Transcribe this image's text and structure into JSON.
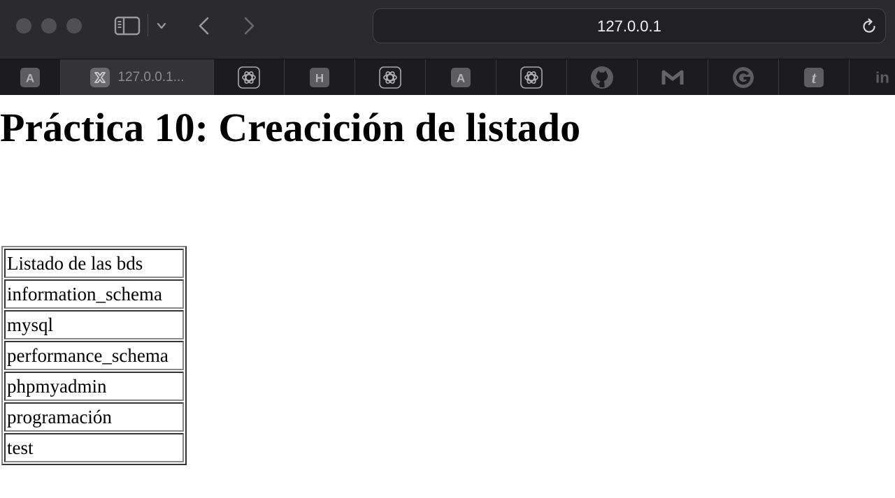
{
  "browser": {
    "url": "127.0.0.1",
    "active_tab_title": "127.0.0.1..."
  },
  "favorites": [
    {
      "name": "a-icon",
      "glyph": "A"
    },
    {
      "name": "xampp-icon",
      "glyph": ""
    },
    {
      "name": "openai-icon",
      "glyph": ""
    },
    {
      "name": "h-icon",
      "glyph": "H"
    },
    {
      "name": "openai-icon",
      "glyph": ""
    },
    {
      "name": "a-icon",
      "glyph": "A"
    },
    {
      "name": "openai-icon",
      "glyph": ""
    },
    {
      "name": "github-icon",
      "glyph": ""
    },
    {
      "name": "gmail-icon",
      "glyph": ""
    },
    {
      "name": "google-icon",
      "glyph": ""
    },
    {
      "name": "t-icon",
      "glyph": "t"
    },
    {
      "name": "in-icon",
      "glyph": "in"
    }
  ],
  "page": {
    "title": "Práctica 10: Creacición de listado",
    "table_rows": [
      "Listado de las bds",
      "information_schema",
      "mysql",
      "performance_schema",
      "phpmyadmin",
      "programación",
      "test"
    ]
  }
}
